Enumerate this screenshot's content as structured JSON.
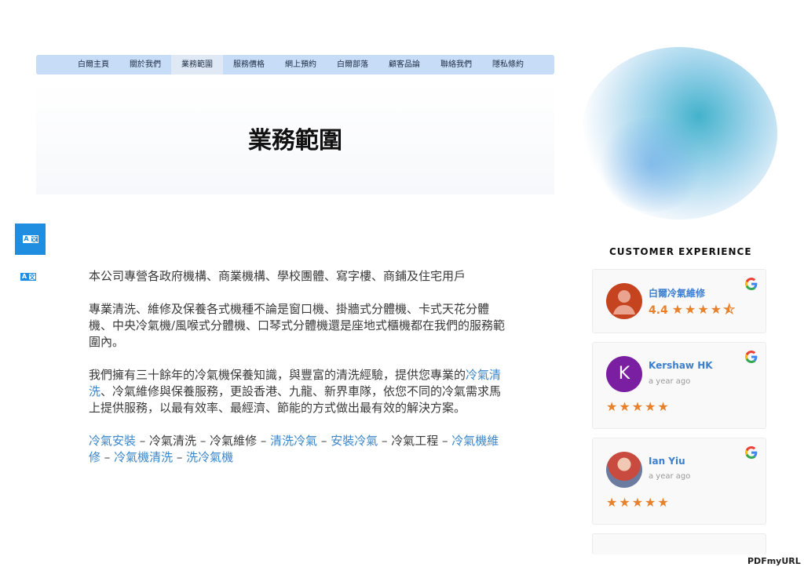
{
  "nav": {
    "items": [
      "白爾主頁",
      "關於我們",
      "業務範圍",
      "服務價格",
      "網上預約",
      "白爾部落",
      "顧客品論",
      "聯絡我們",
      "隱私條約"
    ],
    "active": "業務範圍"
  },
  "hero": {
    "title": "業務範圍"
  },
  "translate": {
    "label_a": "A",
    "label_z": "文"
  },
  "content": {
    "p1": "本公司專營各政府機構、商業機構、學校團體、寫字樓、商鋪及住宅用戶",
    "p2": "專業清洗、維修及保養各式機種不論是窗口機、掛牆式分體機、卡式天花分體機、中央冷氣機/風喉式分體機、口琴式分體機還是座地式櫃機都在我們的服務範圍內。",
    "p3_before": "我們擁有三十餘年的冷氣機保養知識，與豐富的清洗經驗，提供您專業的",
    "p3_link": "冷氣清洗",
    "p3_after": "、冷氣維修與保養服務，更設香港、九龍、新界車隊，依您不同的冷氣需求馬上提供服務，以最有效率、最經濟、節能的方式做出最有效的解決方案。",
    "tags": [
      {
        "text": "冷氣安裝",
        "link": true
      },
      {
        "text": " – 冷氣清洗 – 冷氣維修 – ",
        "link": false
      },
      {
        "text": "清洗冷氣",
        "link": true
      },
      {
        "text": " – ",
        "link": false
      },
      {
        "text": "安裝冷氣",
        "link": true
      },
      {
        "text": " – 冷氣工程 – ",
        "link": false
      },
      {
        "text": "冷氣機維修",
        "link": true
      },
      {
        "text": " – ",
        "link": false
      },
      {
        "text": "冷氣機清洗",
        "link": true
      },
      {
        "text": " – ",
        "link": false
      },
      {
        "text": "洗冷氣機",
        "link": true
      }
    ]
  },
  "reviews": {
    "section_title": "CUSTOMER EXPERIENCE",
    "business": {
      "name": "白爾冷氣維修",
      "rating": "4.4",
      "stars": "★★★★⯪"
    },
    "items": [
      {
        "name": "Kershaw HK",
        "initial": "K",
        "time": "a year ago",
        "stars": "★★★★★",
        "avatar_color": "#7b1fa2"
      },
      {
        "name": "Ian Yiu",
        "initial": "",
        "time": "a year ago",
        "stars": "★★★★★",
        "avatar_color": "#c94a3e"
      }
    ]
  },
  "footer": {
    "logo": "PDFmyURL"
  },
  "colors": {
    "accent": "#3b86c9",
    "nav_bg": "#c7dcf7",
    "star": "#e8812b",
    "translate_btn": "#1f8ee0"
  }
}
